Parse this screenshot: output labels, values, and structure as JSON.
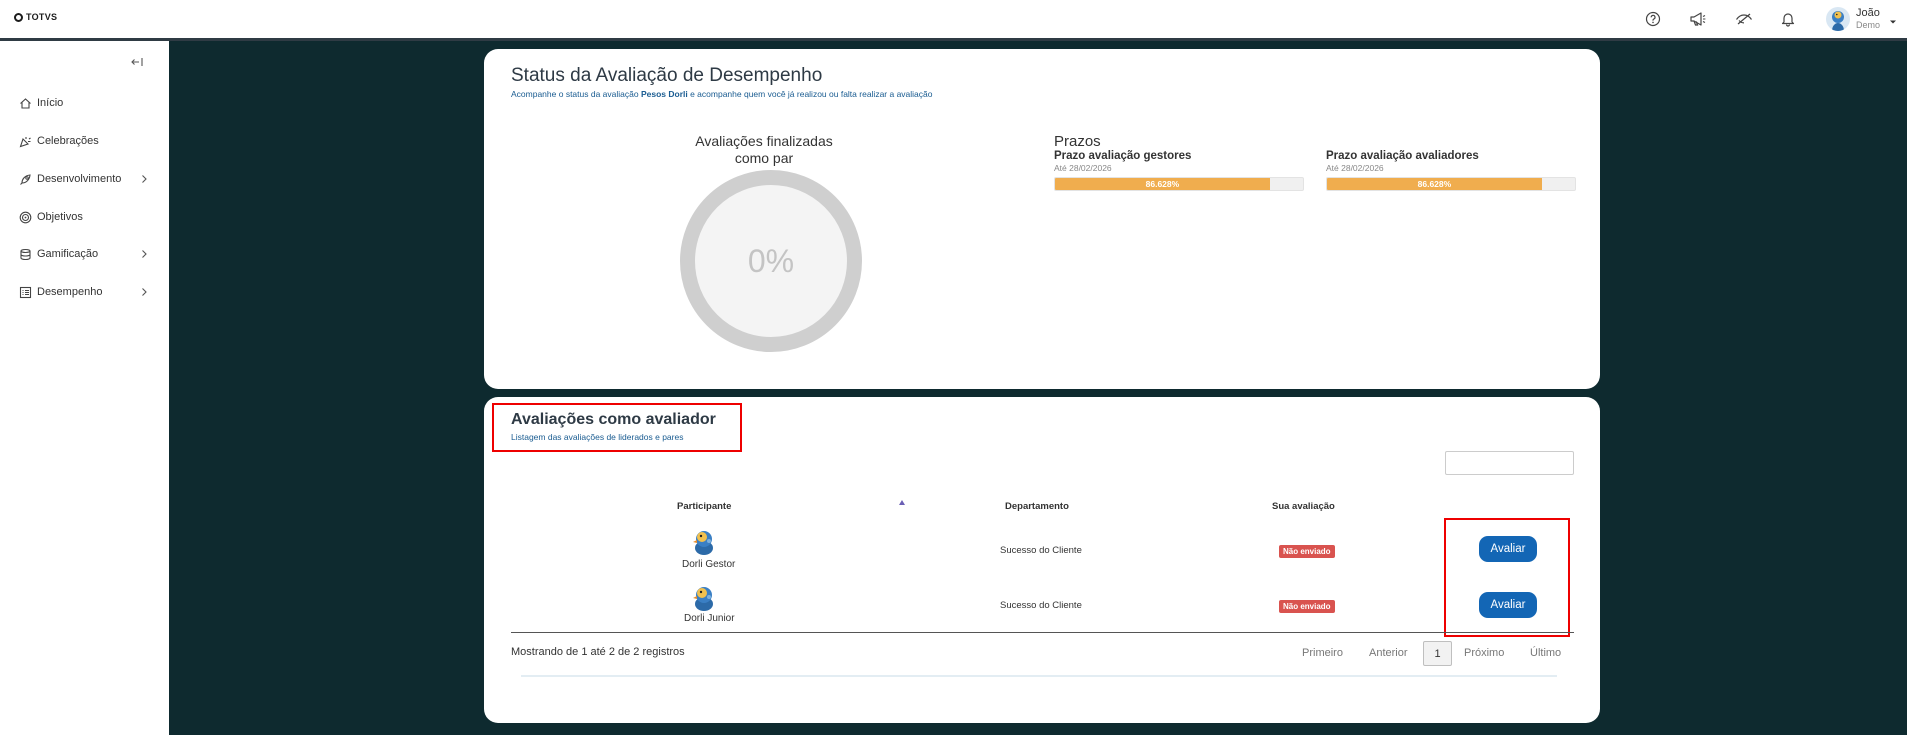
{
  "header": {
    "logo_text": "TOTVS",
    "user": {
      "name": "João",
      "subtitle": "Demo"
    },
    "icons": [
      "help-icon",
      "megaphone-icon",
      "eye-off-icon",
      "bell-icon"
    ]
  },
  "sidebar": {
    "items": [
      {
        "label": "Início",
        "icon": "home-icon",
        "has_children": false
      },
      {
        "label": "Celebrações",
        "icon": "party-icon",
        "has_children": false
      },
      {
        "label": "Desenvolvimento",
        "icon": "rocket-icon",
        "has_children": true
      },
      {
        "label": "Objetivos",
        "icon": "target-icon",
        "has_children": false
      },
      {
        "label": "Gamificação",
        "icon": "coins-icon",
        "has_children": true
      },
      {
        "label": "Desempenho",
        "icon": "checklist-icon",
        "has_children": true
      }
    ]
  },
  "status": {
    "title": "Status da Avaliação de Desempenho",
    "subtitle_pre": "Acompanhe o status da avaliação ",
    "subtitle_bold": "Pesos Dorli",
    "subtitle_post": " e acompanhe quem você já realizou ou falta realizar a avaliação",
    "donut_title": "Avaliações finalizadas como par",
    "donut_value": "0%",
    "donut_fraction": 0,
    "prazos_title": "Prazos",
    "prazos": [
      {
        "label": "Prazo avaliação gestores",
        "date": "Até 28/02/2026",
        "value_text": "86.628%",
        "value": 86.628
      },
      {
        "label": "Prazo avaliação avaliadores",
        "date": "Até 28/02/2026",
        "value_text": "86.628%",
        "value": 86.628
      }
    ]
  },
  "evaluator": {
    "title": "Avaliações como avaliador",
    "subtitle": "Listagem das avaliações de liderados e pares",
    "search_value": "",
    "columns": [
      "Participante",
      "Departamento",
      "Sua avaliação"
    ],
    "rows": [
      {
        "name": "Dorli Gestor",
        "department": "Sucesso do Cliente",
        "status": "Não enviado",
        "action": "Avaliar"
      },
      {
        "name": "Dorli Junior",
        "department": "Sucesso do Cliente",
        "status": "Não enviado",
        "action": "Avaliar"
      }
    ],
    "info": "Mostrando de 1 até 2 de 2 registros",
    "pagination": {
      "first": "Primeiro",
      "prev": "Anterior",
      "current": "1",
      "next": "Próximo",
      "last": "Último"
    }
  },
  "colors": {
    "dark_bg": "#0e2a2f",
    "primary": "#1366b5",
    "warning": "#f0ad4e",
    "danger": "#d9534f",
    "highlight": "#e00000"
  }
}
